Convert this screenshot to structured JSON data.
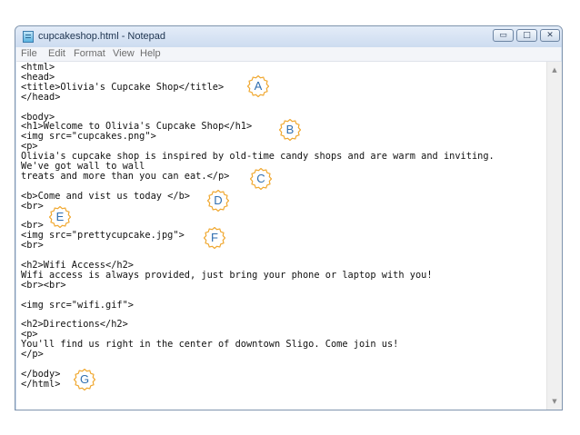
{
  "window": {
    "title": "cupcakeshop.html - Notepad",
    "buttons": {
      "minimize": "▭",
      "maximize": "□",
      "close": "✕"
    }
  },
  "menu": {
    "file": "File",
    "edit": "Edit",
    "format": "Format",
    "view": "View",
    "help": "Help"
  },
  "code_lines": [
    "<html>",
    "<head>",
    "<title>Olivia's Cupcake Shop</title>",
    "</head>",
    "",
    "<body>",
    "<h1>Welcome to Olivia's Cupcake Shop</h1>",
    "<img src=\"cupcakes.png\">",
    "<p>",
    "Olivia's cupcake shop is inspired by old-time candy shops and are warm and inviting.",
    "We've got wall to wall",
    "treats and more than you can eat.</p>",
    "",
    "<b>Come and vist us today </b>",
    "<br>",
    "",
    "<br>",
    "<img src=\"prettycupcake.jpg\">",
    "<br>",
    "",
    "<h2>Wifi Access</h2>",
    "Wifi access is always provided, just bring your phone or laptop with you!",
    "<br><br>",
    "",
    "<img src=\"wifi.gif\">",
    "",
    "<h2>Directions</h2>",
    "<p>",
    "You'll find us right in the center of downtown Sligo. Come join us!",
    "</p>",
    "",
    "</body>",
    "</html>"
  ],
  "markers": [
    "A",
    "B",
    "C",
    "D",
    "E",
    "F",
    "G"
  ],
  "colors": {
    "marker_stroke": "#f0a830",
    "marker_text": "#2f6eb0",
    "titlebar": "#d6e3f3"
  },
  "icons": {
    "app": "notepad-icon",
    "scroll_up": "scroll-up-arrow-icon",
    "scroll_down": "scroll-down-arrow-icon"
  }
}
